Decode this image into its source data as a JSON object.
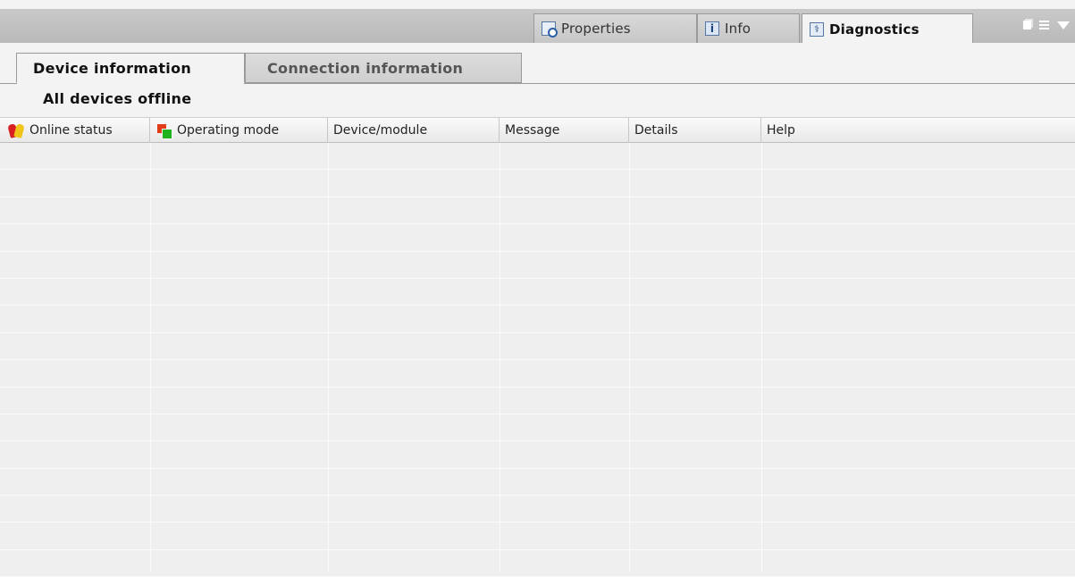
{
  "inspector_tabs": [
    {
      "label": "Properties",
      "icon": "properties-icon",
      "active": false
    },
    {
      "label": "Info",
      "icon": "info-icon",
      "active": false
    },
    {
      "label": "Diagnostics",
      "icon": "diagnostics-icon",
      "active": true
    }
  ],
  "sub_tabs": [
    {
      "label": "Device information",
      "active": true
    },
    {
      "label": "Connection information",
      "active": false
    }
  ],
  "status_title": "All devices offline",
  "table": {
    "columns": [
      {
        "label": "Online status",
        "icon": "online-status-icon"
      },
      {
        "label": "Operating mode",
        "icon": "operating-mode-icon"
      },
      {
        "label": "Device/module",
        "icon": ""
      },
      {
        "label": "Message",
        "icon": ""
      },
      {
        "label": "Details",
        "icon": ""
      },
      {
        "label": "Help",
        "icon": ""
      }
    ],
    "rows": []
  },
  "colors": {
    "title_strip": "#c0c0c0",
    "panel_bg": "#f3f3f3",
    "row_bg": "#efefef"
  }
}
